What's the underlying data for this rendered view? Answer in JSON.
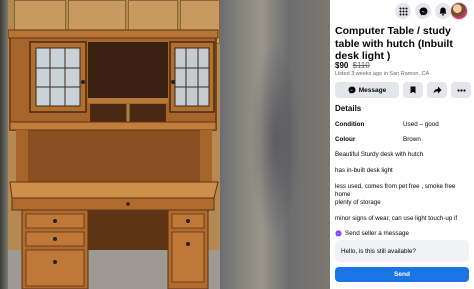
{
  "topbar": {
    "icons": [
      "grid-menu-icon",
      "messenger-icon",
      "notifications-bell-icon",
      "profile-avatar"
    ]
  },
  "listing": {
    "title": "Computer Table / study table with hutch (Inbuilt desk light )",
    "price": "$90",
    "original_price": "$110",
    "listed_info": "Listed 3 weeks ago in San Ramon, CA"
  },
  "actions": {
    "message_label": "Message",
    "icons": [
      "messenger-icon",
      "bookmark-icon",
      "share-icon",
      "more-icon"
    ]
  },
  "details": {
    "heading": "Details",
    "rows": [
      {
        "key": "Condition",
        "value": "Used – good"
      },
      {
        "key": "Colour",
        "value": "Brown"
      }
    ],
    "description_lines": [
      "Beautiful Sturdy desk with hutch",
      "has in-built desk light",
      "less used, comes from pet free , smoke free",
      "home",
      "plenty of storage",
      "minor signs of wear, can use light touch-up if"
    ]
  },
  "seller_message": {
    "label": "Send seller a message",
    "input_value": "Hello, is this still available?",
    "send_label": "Send"
  },
  "colors": {
    "accent": "#1b74e4",
    "button_bg": "#e4e6eb",
    "secondary_text": "#65676b"
  }
}
